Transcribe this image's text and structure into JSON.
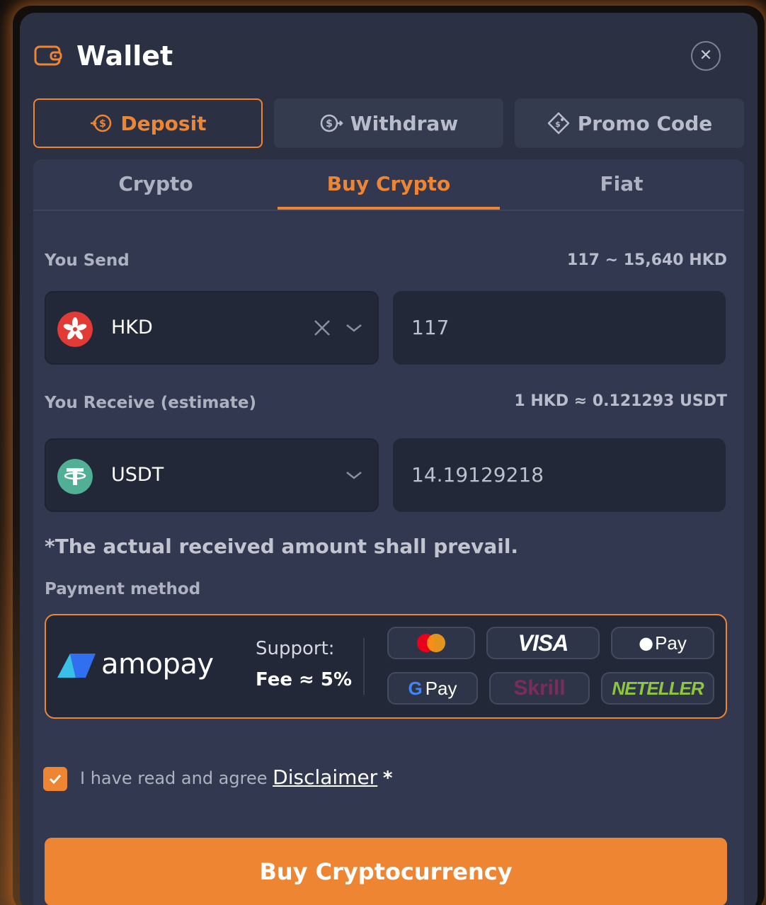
{
  "header": {
    "title": "Wallet"
  },
  "main_tabs": [
    {
      "label": "Deposit"
    },
    {
      "label": "Withdraw"
    },
    {
      "label": "Promo Code"
    }
  ],
  "sub_tabs": [
    {
      "label": "Crypto"
    },
    {
      "label": "Buy Crypto"
    },
    {
      "label": "Fiat"
    }
  ],
  "send": {
    "label": "You Send",
    "range": "117 ~ 15,640 HKD",
    "currency": "HKD",
    "amount": "117"
  },
  "receive": {
    "label": "You Receive (estimate)",
    "rate": "1 HKD ≈ 0.121293 USDT",
    "currency": "USDT",
    "amount": "14.19129218"
  },
  "note": "*The actual received amount shall prevail.",
  "payment": {
    "label": "Payment method",
    "provider": "amopay",
    "support": "Support:",
    "fee": "Fee ≈ 5%",
    "methods": [
      "mastercard",
      "VISA",
      "Pay",
      "Pay",
      "Skrill",
      "NETELLER"
    ]
  },
  "agree": {
    "text": "I have read and agree",
    "link": "Disclaimer",
    "required": "*"
  },
  "buy_button": "Buy Cryptocurrency",
  "colors": {
    "accent": "#ee8533",
    "panel": "#323850",
    "field": "#232838"
  }
}
